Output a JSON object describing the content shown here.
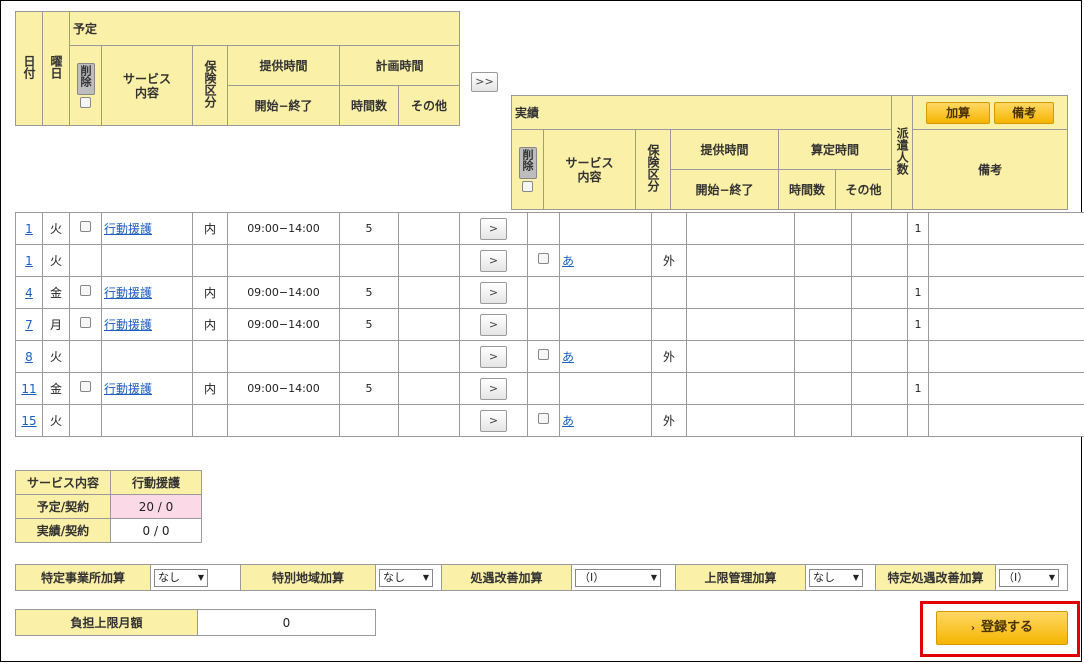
{
  "plan": {
    "headers": {
      "date": "日付",
      "dow": "曜日",
      "yotei": "予定",
      "delete": "削除",
      "service": "サービス内容",
      "insurance": "保険区分",
      "provide_time": "提供時間",
      "plan_time": "計画時間",
      "start_end": "開始−終了",
      "hours": "時間数",
      "other": "その他"
    },
    "copy_all_label": ">>"
  },
  "actual": {
    "headers": {
      "jisseki": "実績",
      "delete": "削除",
      "service": "サービス内容",
      "insurance": "保険区分",
      "provide_time": "提供時間",
      "calc_time": "算定時間",
      "start_end": "開始−終了",
      "hours": "時間数",
      "other": "その他",
      "dispatch": "派遣人数",
      "notes": "備考"
    },
    "kasan_button": "加算",
    "biko_button": "備考"
  },
  "copy_row_label": ">",
  "rows": [
    {
      "day": "1",
      "dow": "火",
      "plan_check": true,
      "plan_service": "行動援護",
      "plan_ins": "内",
      "plan_time": "09:00−14:00",
      "plan_hours": "5",
      "act_check": false,
      "act_service": "",
      "act_ins": "",
      "dispatch": "1"
    },
    {
      "day": "1",
      "dow": "火",
      "plan_check": false,
      "plan_service": "",
      "plan_ins": "",
      "plan_time": "",
      "plan_hours": "",
      "act_check": true,
      "act_service": "あ",
      "act_ins": "外",
      "dispatch": ""
    },
    {
      "day": "4",
      "dow": "金",
      "plan_check": true,
      "plan_service": "行動援護",
      "plan_ins": "内",
      "plan_time": "09:00−14:00",
      "plan_hours": "5",
      "act_check": false,
      "act_service": "",
      "act_ins": "",
      "dispatch": "1"
    },
    {
      "day": "7",
      "dow": "月",
      "plan_check": true,
      "plan_service": "行動援護",
      "plan_ins": "内",
      "plan_time": "09:00−14:00",
      "plan_hours": "5",
      "act_check": false,
      "act_service": "",
      "act_ins": "",
      "dispatch": "1"
    },
    {
      "day": "8",
      "dow": "火",
      "plan_check": false,
      "plan_service": "",
      "plan_ins": "",
      "plan_time": "",
      "plan_hours": "",
      "act_check": true,
      "act_service": "あ",
      "act_ins": "外",
      "dispatch": ""
    },
    {
      "day": "11",
      "dow": "金",
      "plan_check": true,
      "plan_service": "行動援護",
      "plan_ins": "内",
      "plan_time": "09:00−14:00",
      "plan_hours": "5",
      "act_check": false,
      "act_service": "",
      "act_ins": "",
      "dispatch": "1"
    },
    {
      "day": "15",
      "dow": "火",
      "plan_check": false,
      "plan_service": "",
      "plan_ins": "",
      "plan_time": "",
      "plan_hours": "",
      "act_check": true,
      "act_service": "あ",
      "act_ins": "外",
      "dispatch": ""
    }
  ],
  "summary": {
    "service_label": "サービス内容",
    "service_value": "行動援護",
    "plan_label": "予定/契約",
    "plan_value": "20 / 0",
    "actual_label": "実績/契約",
    "actual_value": "0 / 0"
  },
  "addons": {
    "tokutei_label": "特定事業所加算",
    "tokutei_value": "なし",
    "tokubetsu_label": "特別地域加算",
    "tokubetsu_value": "なし",
    "shogu_label": "処遇改善加算",
    "shogu_value": "（Ⅰ）",
    "jogen_label": "上限管理加算",
    "jogen_value": "なし",
    "tokutei_shogu_label": "特定処遇改善加算",
    "tokutei_shogu_value": "（Ⅰ）"
  },
  "burden": {
    "label": "負担上限月額",
    "value": "0"
  },
  "register_button": "登録する",
  "colors": {
    "header_yellow": "#fbf0a8",
    "link_blue": "#1a5fc4",
    "pink": "#fbd9e6",
    "orange_button": "#f5b400",
    "highlight_red": "#e00000"
  }
}
